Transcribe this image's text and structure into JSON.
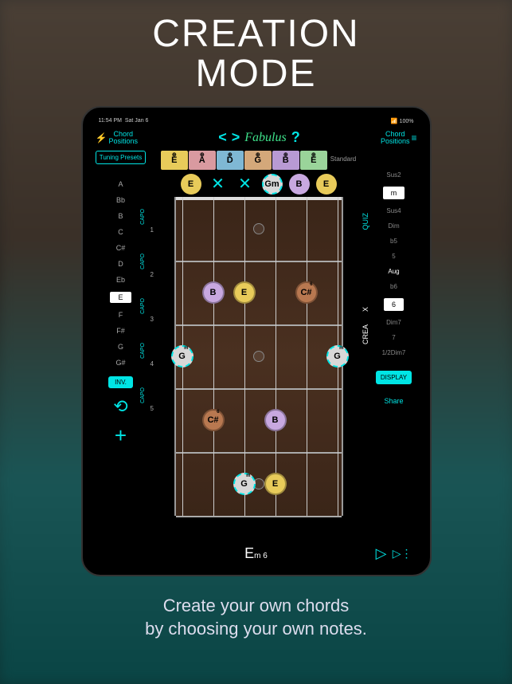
{
  "hero": {
    "line1": "CREATION",
    "line2": "MODE"
  },
  "caption": {
    "line1": "Create your own chords",
    "line2": "by choosing your own notes."
  },
  "status": {
    "time": "11:54 PM",
    "date": "Sat Jan 6",
    "battery": "100%"
  },
  "header": {
    "chord_positions": "Chord\nPositions",
    "app_name": "Fabulus",
    "help": "?"
  },
  "tuning_presets_label": "Tuning Presets",
  "tuning": {
    "cells": [
      {
        "note": "E",
        "color": "#e8cb5a"
      },
      {
        "note": "A",
        "color": "#d99aa0"
      },
      {
        "note": "D",
        "color": "#7fb8d4"
      },
      {
        "note": "G",
        "color": "#d4a87a"
      },
      {
        "note": "B",
        "color": "#b89ad4"
      },
      {
        "note": "E",
        "color": "#9ad49a"
      }
    ],
    "label": "Standard"
  },
  "root_notes": [
    "A",
    "Bb",
    "B",
    "C",
    "C#",
    "D",
    "Eb",
    "E",
    "F",
    "F#",
    "G",
    "G#"
  ],
  "root_selected": "E",
  "capo_positions": [
    1,
    2,
    3,
    4,
    5
  ],
  "inv_label": "INV.",
  "modifiers": [
    "Sus2",
    "m",
    "Sus4",
    "Dim",
    "b5",
    "5",
    "Aug",
    "b6",
    "6",
    "Dim7",
    "7",
    "1/2Dim7"
  ],
  "modifier_selected_1": "m",
  "modifier_selected_2": "6",
  "vertical_labels": {
    "quiz": "QUIZ",
    "crea": "CREA",
    "x": "X"
  },
  "display_label": "DISPLAY",
  "share_label": "Share",
  "open_markers": [
    {
      "type": "note",
      "label": "E",
      "bg": "#e8cb5a"
    },
    {
      "type": "x"
    },
    {
      "type": "x"
    },
    {
      "type": "note",
      "label": "G",
      "bg": "#d8d8d8",
      "dashed": true,
      "sup": "m"
    },
    {
      "type": "note",
      "label": "B",
      "bg": "#c8a8e0"
    },
    {
      "type": "note",
      "label": "E",
      "bg": "#e8cb5a"
    }
  ],
  "fretboard": {
    "frets": 5,
    "inlays": [
      3,
      5
    ],
    "notes": [
      {
        "string": 1,
        "fret": 2,
        "label": "B",
        "bg": "#c8a8e0"
      },
      {
        "string": 2,
        "fret": 2,
        "label": "E",
        "bg": "#e8cb5a"
      },
      {
        "string": 4,
        "fret": 2,
        "label": "C#",
        "bg": "#b87850",
        "sup": "6"
      },
      {
        "string": 0,
        "fret": 3,
        "label": "G",
        "bg": "#d8d8d8",
        "dashed": true,
        "sup": "m"
      },
      {
        "string": 5,
        "fret": 3,
        "label": "G",
        "bg": "#d8d8d8",
        "dashed": true,
        "sup": "m"
      },
      {
        "string": 1,
        "fret": 4,
        "label": "C#",
        "bg": "#b87850",
        "sup": "6"
      },
      {
        "string": 3,
        "fret": 4,
        "label": "B",
        "bg": "#c8a8e0"
      },
      {
        "string": 2,
        "fret": 5,
        "label": "G",
        "bg": "#d8d8d8",
        "dashed": true,
        "sup": "m"
      },
      {
        "string": 3,
        "fret": 5,
        "label": "E",
        "bg": "#e8cb5a"
      }
    ]
  },
  "chord_display": {
    "root": "E",
    "suffix": "m 6"
  }
}
